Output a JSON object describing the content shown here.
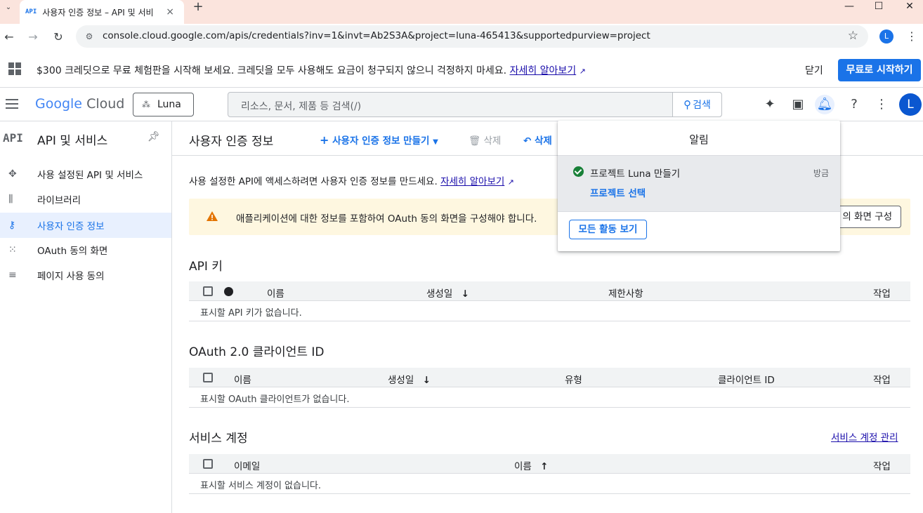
{
  "browser": {
    "tab_title": "사용자 인증 정보 – API 및 서비",
    "tab_favicon": "API",
    "url": "console.cloud.google.com/apis/credentials?inv=1&invt=Ab2S3A&project=luna-465413&supportedpurview=project",
    "profile_initial": "L"
  },
  "promo": {
    "text": "$300 크레딧으로 무료 체험판을 시작해 보세요. 크레딧을 모두 사용해도 요금이 청구되지 않으니 걱정하지 마세요.",
    "link": "자세히 알아보기",
    "close_label": "닫기",
    "start_label": "무료로 시작하기"
  },
  "header": {
    "logo_google": "Google",
    "logo_cloud": "Cloud",
    "project": "Luna",
    "search_placeholder": "리소스, 문서, 제품 등 검색(/)",
    "search_button": "검색",
    "avatar_initial": "L"
  },
  "sidebar": {
    "badge": "API",
    "title": "API 및 서비스",
    "items": [
      {
        "label": "사용 설정된 API 및 서비스",
        "icon": "diamond-network-icon"
      },
      {
        "label": "라이브러리",
        "icon": "library-icon"
      },
      {
        "label": "사용자 인증 정보",
        "icon": "key-icon",
        "active": true
      },
      {
        "label": "OAuth 동의 화면",
        "icon": "oauth-dots-icon"
      },
      {
        "label": "페이지 사용 동의",
        "icon": "page-settings-icon"
      }
    ]
  },
  "main": {
    "title": "사용자 인증 정보",
    "create_label": "사용자 인증 정보 만들기",
    "delete_label": "삭제",
    "restore_label": "삭제",
    "intro_text": "사용 설정한 API에 액세스하려면 사용자 인증 정보를 만드세요.",
    "intro_link": "자세히 알아보기",
    "warning_text": "애플리케이션에 대한 정보를 포함하여 OAuth 동의 화면을 구성해야 합니다.",
    "warning_button": "의 화면 구성"
  },
  "api_keys": {
    "title": "API 키",
    "headers": {
      "name": "이름",
      "created": "생성일",
      "restrictions": "제한사항",
      "actions": "작업"
    },
    "empty": "표시할 API 키가 없습니다."
  },
  "oauth": {
    "title": "OAuth 2.0 클라이언트 ID",
    "headers": {
      "name": "이름",
      "created": "생성일",
      "type": "유형",
      "client_id": "클라이언트 ID",
      "actions": "작업"
    },
    "empty": "표시할 OAuth 클라이언트가 없습니다."
  },
  "service_accounts": {
    "title": "서비스 계정",
    "manage_link": "서비스 계정 관리",
    "headers": {
      "email": "이메일",
      "name": "이름",
      "actions": "작업"
    },
    "empty": "표시할 서비스 계정이 없습니다."
  },
  "notifications": {
    "title": "알림",
    "item_message": "프로젝트 Luna 만들기",
    "item_time": "방금",
    "item_link": "프로젝트 선택",
    "view_all": "모든 활동 보기"
  },
  "colors": {
    "accent": "#1a73e8",
    "warning_bg": "#fef7e0",
    "success": "#188038"
  }
}
